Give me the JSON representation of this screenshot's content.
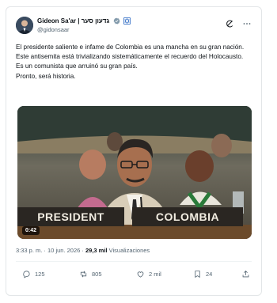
{
  "post": {
    "author": {
      "display_name": "Gideon Sa'ar | גדעון סער",
      "handle": "@gidonsaar"
    },
    "text": [
      "El presidente saliente e infame de Colombia es una mancha en su gran nación.",
      "Este antisemita está trivializando sistemáticamente el recuerdo del Holocausto.",
      "Es un comunista que arruinó su gran país.",
      "Pronto, será historia."
    ],
    "media": {
      "duration": "0:42",
      "placard_left": "PRESIDENT",
      "placard_right": "COLOMBIA"
    },
    "timestamp": "3:33 p. m. · 10 jun. 2026",
    "views_count": "29,3 mil",
    "views_label": "Visualizaciones",
    "views_separator": " · ",
    "actions": {
      "replies": "125",
      "reposts": "805",
      "likes": "2 mil",
      "bookmarks": "24"
    }
  },
  "icons": {
    "verified": "verified-badge-icon",
    "affiliate": "government-affiliate-icon",
    "grok": "grok-icon",
    "more": "more-icon",
    "reply": "reply-icon",
    "repost": "repost-icon",
    "like": "like-icon",
    "bookmark": "bookmark-icon",
    "share": "share-icon"
  },
  "colors": {
    "verified": "#829aab",
    "text": "#0f1419",
    "muted": "#536471",
    "placard_bg": "#2a2622",
    "placard_text": "#f2ede2"
  }
}
